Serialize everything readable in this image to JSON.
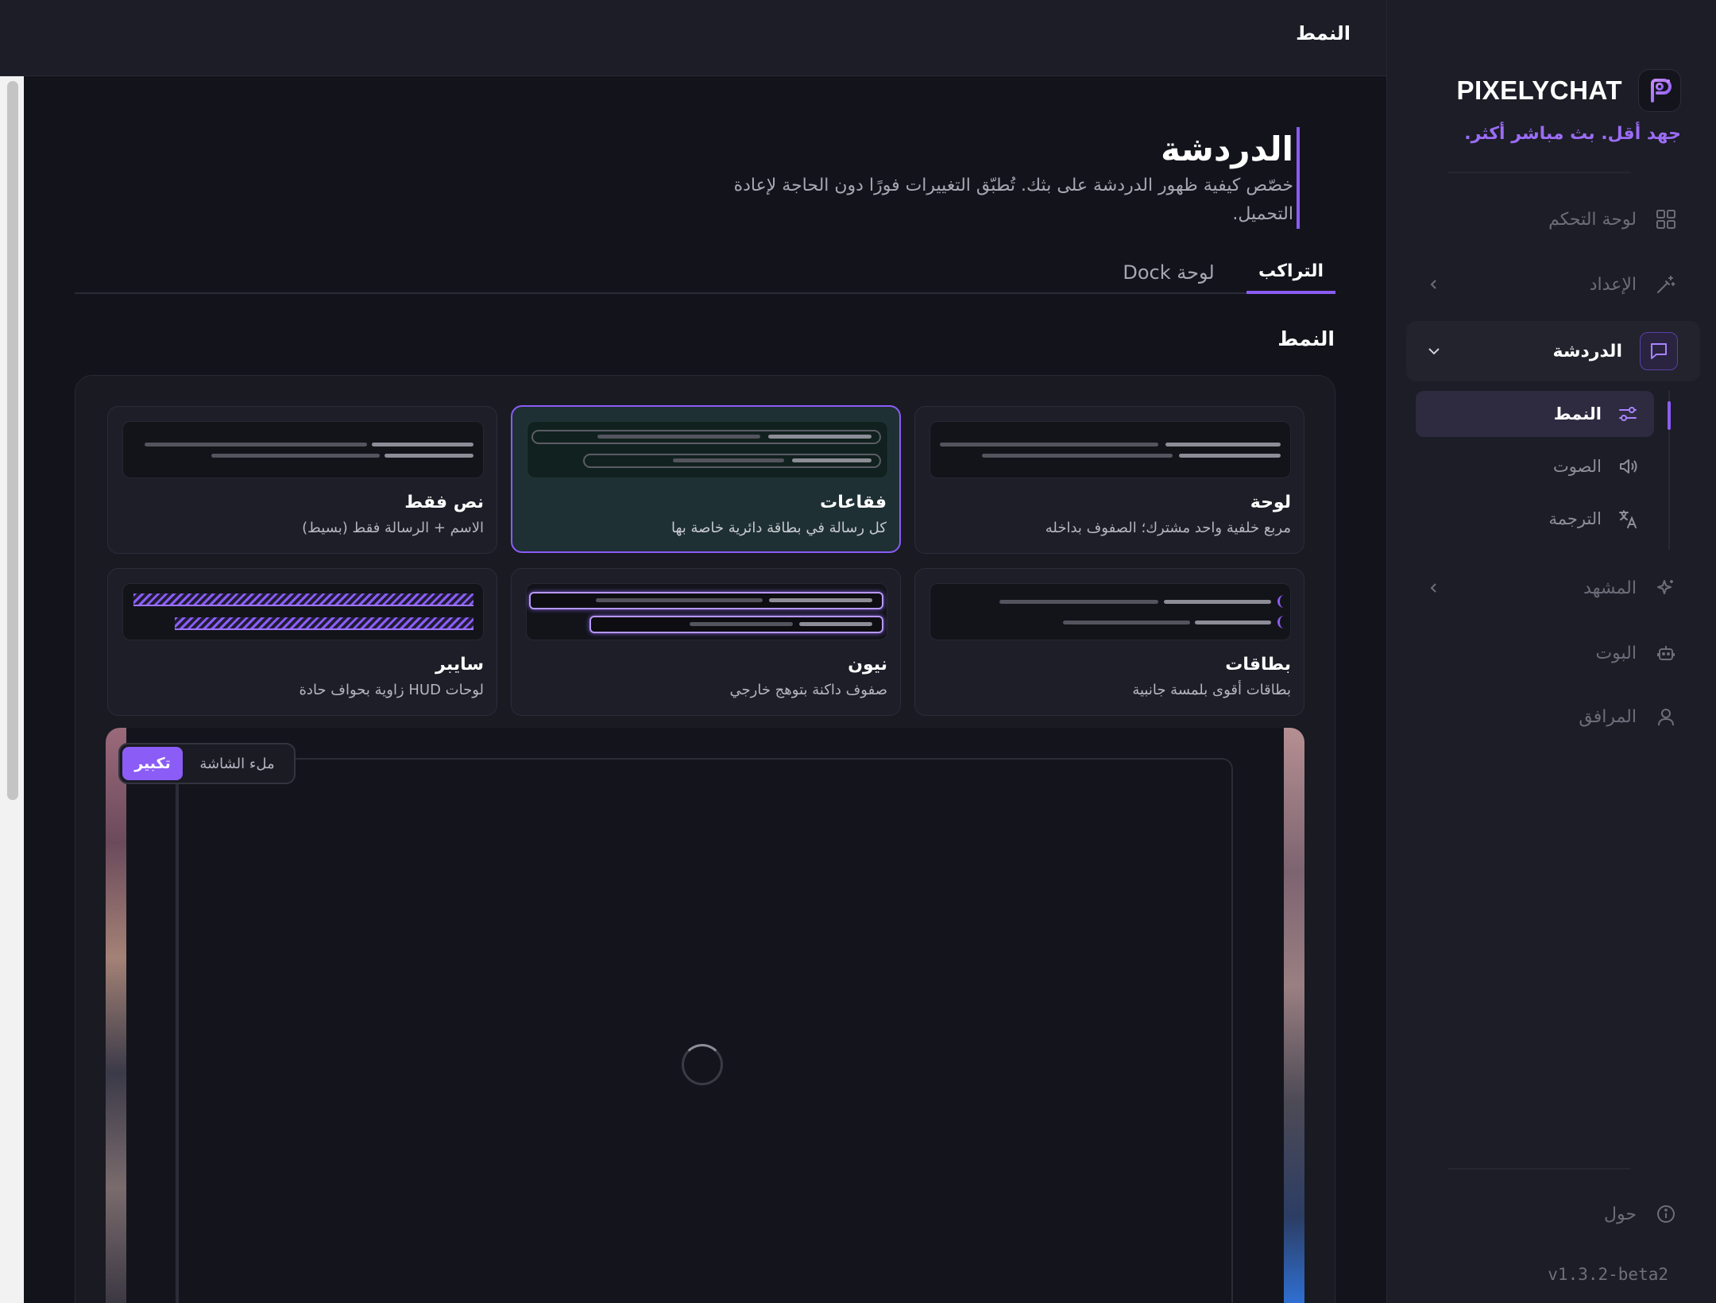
{
  "app": {
    "brand": "PIXELYCHAT",
    "tagline": "جهد أقل. بث مباشر أكثر.",
    "version": "v1.3.2-beta2",
    "accent": "#8b5cf6"
  },
  "topbar": {
    "title": "النمط"
  },
  "sidebar": {
    "items": [
      {
        "label": "لوحة التحكم",
        "icon": "grid-icon"
      },
      {
        "label": "الإعداد",
        "icon": "wand-icon"
      },
      {
        "label": "الدردشة",
        "icon": "chat-icon"
      },
      {
        "label": "المشهد",
        "icon": "sparkle-icon"
      },
      {
        "label": "البوت",
        "icon": "bot-icon"
      },
      {
        "label": "المرافق",
        "icon": "user-icon"
      }
    ],
    "chat_sub": [
      {
        "label": "النمط",
        "icon": "sliders-icon"
      },
      {
        "label": "الصوت",
        "icon": "speaker-icon"
      },
      {
        "label": "الترجمة",
        "icon": "translate-icon"
      }
    ],
    "about": {
      "label": "حول",
      "icon": "info-icon"
    }
  },
  "page": {
    "title": "الدردشة",
    "subtitle": "خصّص كيفية ظهور الدردشة على بثك. تُطبّق التغييرات فورًا دون الحاجة لإعادة التحميل."
  },
  "tabs": [
    {
      "label": "التراكب",
      "active": true
    },
    {
      "label": "لوحة Dock",
      "active": false
    }
  ],
  "section": {
    "title": "النمط"
  },
  "styles": [
    {
      "title": "لوحة",
      "desc": "مربع خلفية واحد مشترك؛ الصفوف بداخله",
      "selected": false
    },
    {
      "title": "فقاعات",
      "desc": "كل رسالة في بطاقة دائرية خاصة بها",
      "selected": true
    },
    {
      "title": "نص فقط",
      "desc": "الاسم + الرسالة فقط (بسيط)",
      "selected": false
    },
    {
      "title": "بطاقات",
      "desc": "بطاقات أقوى بلمسة جانبية",
      "selected": false
    },
    {
      "title": "نيون",
      "desc": "صفوف داكنة بتوهج خارجي",
      "selected": false
    },
    {
      "title": "سايبر",
      "desc": "لوحات HUD زاوية بحواف حادة",
      "selected": false
    }
  ],
  "preview": {
    "zoom_label": "تكبير",
    "fill_label": "ملء الشاشة"
  }
}
